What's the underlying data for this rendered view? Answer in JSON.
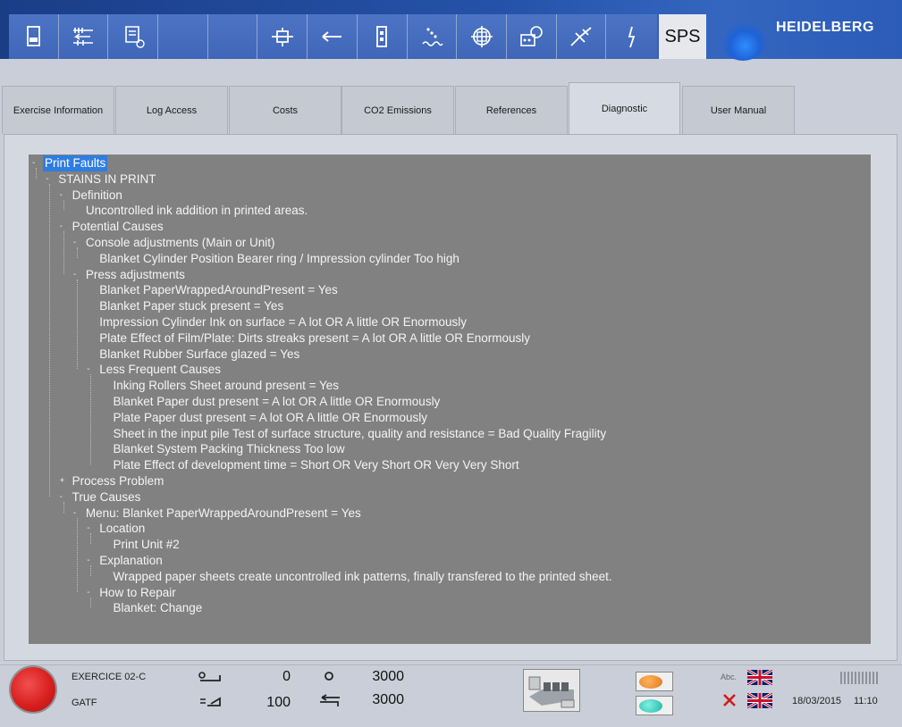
{
  "app": {
    "brand": "HEIDELBERG",
    "sps_label": "SPS"
  },
  "toolbar": {
    "buttons": [
      {
        "icon": "job-card-icon"
      },
      {
        "icon": "transfer-settings-icon"
      },
      {
        "icon": "document-clock-icon"
      },
      {
        "icon": "blank-icon"
      },
      {
        "icon": "blank-icon"
      },
      {
        "icon": "feeder-icon"
      },
      {
        "icon": "arrow-left-icon"
      },
      {
        "icon": "unit-icon"
      },
      {
        "icon": "dampening-icon"
      },
      {
        "icon": "register-icon"
      },
      {
        "icon": "color-measure-icon"
      },
      {
        "icon": "path-icon"
      },
      {
        "icon": "electrical-icon"
      }
    ]
  },
  "tabs": [
    {
      "label": "Exercise Information"
    },
    {
      "label": "Log Access"
    },
    {
      "label": "Costs"
    },
    {
      "label": "CO2 Emissions"
    },
    {
      "label": "References"
    },
    {
      "label": "Diagnostic",
      "active": true
    },
    {
      "label": "User Manual"
    }
  ],
  "tree": [
    {
      "text": "Print Faults",
      "level": 0,
      "toggle": "-",
      "selected": true
    },
    {
      "text": "STAINS IN PRINT",
      "level": 1,
      "toggle": "-"
    },
    {
      "text": "Definition",
      "level": 2,
      "toggle": "-"
    },
    {
      "text": "Uncontrolled ink addition in printed areas.",
      "level": 3
    },
    {
      "text": "Potential Causes",
      "level": 2,
      "toggle": "-"
    },
    {
      "text": "Console adjustments (Main or Unit)",
      "level": 3,
      "toggle": "-"
    },
    {
      "text": "Blanket Cylinder  Position Bearer ring / Impression cylinder Too high",
      "level": 4
    },
    {
      "text": "Press adjustments",
      "level": 3,
      "toggle": "-"
    },
    {
      "text": "Blanket PaperWrappedAroundPresent = Yes",
      "level": 4
    },
    {
      "text": "Blanket  Paper stuck present = Yes",
      "level": 4
    },
    {
      "text": "Impression Cylinder  Ink on surface = A lot OR A little OR Enormously",
      "level": 4
    },
    {
      "text": "Plate  Effect of Film/Plate: Dirts streaks present = A lot OR A little OR Enormously",
      "level": 4
    },
    {
      "text": "Blanket  Rubber Surface glazed = Yes",
      "level": 4
    },
    {
      "text": "Less Frequent Causes",
      "level": 4,
      "toggle": "-"
    },
    {
      "text": "Inking Rollers  Sheet around present = Yes",
      "level": 5
    },
    {
      "text": "Blanket  Paper dust present = A lot OR A little OR Enormously",
      "level": 5
    },
    {
      "text": "Plate  Paper dust present = A lot OR A little OR Enormously",
      "level": 5
    },
    {
      "text": "Sheet in the input pile  Test of surface structure, quality and resistance = Bad Quality Fragility",
      "level": 5
    },
    {
      "text": "Blanket System Packing  Thickness Too low",
      "level": 5
    },
    {
      "text": "Plate  Effect of development time = Short OR Very Short OR  Very Very Short",
      "level": 5
    },
    {
      "text": "Process Problem",
      "level": 2,
      "toggle": "+"
    },
    {
      "text": "True Causes",
      "level": 2,
      "toggle": "-"
    },
    {
      "text": "Menu: Blanket PaperWrappedAroundPresent = Yes",
      "level": 3,
      "toggle": "-"
    },
    {
      "text": "Location",
      "level": 4,
      "toggle": "-"
    },
    {
      "text": "Print Unit #2",
      "level": 5
    },
    {
      "text": "Explanation",
      "level": 4,
      "toggle": "-"
    },
    {
      "text": "Wrapped paper sheets create uncontrolled ink patterns, finally transfered to the printed sheet.",
      "level": 5
    },
    {
      "text": "How to Repair",
      "level": 4,
      "toggle": "-"
    },
    {
      "text": "Blanket: Change",
      "level": 5
    }
  ],
  "status": {
    "exercise": "EXERCICE 02-C",
    "org": "GATF",
    "counter_top": "0",
    "counter_bottom": "100",
    "speed_top": "3000",
    "speed_bottom": "3000",
    "abc_label": "Abc.",
    "date": "18/03/2015",
    "time": "11:10",
    "lamp_top_color": "#e07a1f",
    "lamp_bottom_color": "#1fb8a8"
  }
}
